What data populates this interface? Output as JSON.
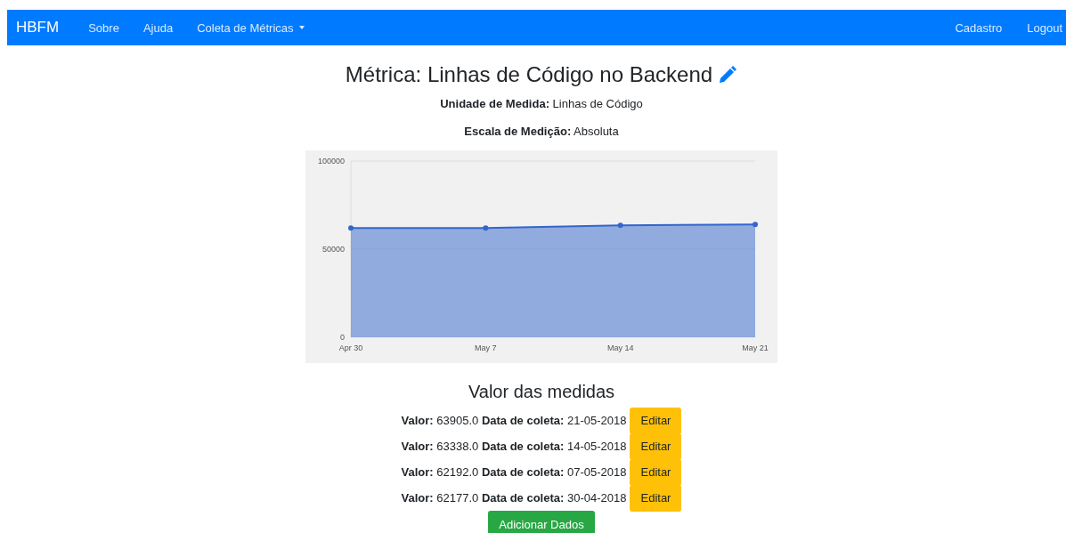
{
  "navbar": {
    "brand": "HBFM",
    "links": [
      {
        "label": "Sobre",
        "kind": "link"
      },
      {
        "label": "Ajuda",
        "kind": "link"
      },
      {
        "label": "Coleta de Métricas",
        "kind": "dropdown"
      }
    ],
    "right_links": [
      "Cadastro",
      "Logout"
    ]
  },
  "title": "Métrica: Linhas de Código no Backend",
  "details": [
    "**Unidade de Medida:** Linhas de Código",
    "**Escala de Medição:** Absoluta"
  ],
  "chart_data": {
    "type": "area",
    "categories": [
      "Apr 30",
      "May 7",
      "May 14",
      "May 21"
    ],
    "series": [
      {
        "color": "#3366cc",
        "values": [
          62000,
          62000,
          63500,
          64000
        ]
      }
    ],
    "ylim": [
      0,
      100000
    ],
    "yticks": [
      0,
      50000,
      100000
    ]
  },
  "measures_title": "Valor das medidas",
  "measures": [
    {
      "text": "**Valor:** 63905.0 **Data de coleta:** 21-05-2018",
      "button": "Editar"
    },
    {
      "text": "**Valor:** 63338.0 **Data de coleta:** 14-05-2018",
      "button": "Editar"
    },
    {
      "text": "**Valor:** 62192.0 **Data de coleta:** 07-05-2018",
      "button": "Editar"
    },
    {
      "text": "**Valor:** 62177.0 **Data de coleta:** 30-04-2018",
      "button": "Editar"
    }
  ],
  "add_button": "Adicionar Dados"
}
